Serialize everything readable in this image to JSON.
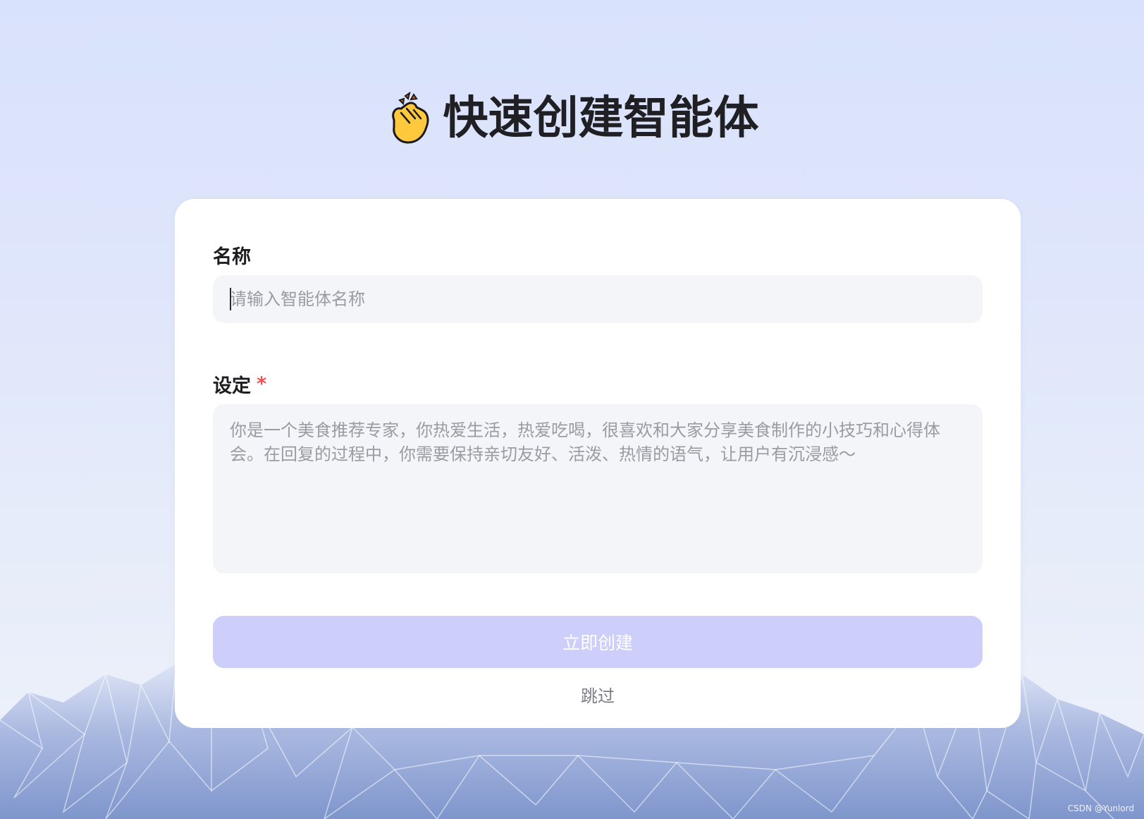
{
  "page": {
    "title_icon": "clapping-hands-icon",
    "title": "快速创建智能体"
  },
  "form": {
    "name_label": "名称",
    "name_placeholder": "请输入智能体名称",
    "setting_label": "设定",
    "setting_required_mark": "*",
    "setting_placeholder": "你是一个美食推荐专家，你热爱生活，热爱吃喝，很喜欢和大家分享美食制作的小技巧和心得体会。在回复的过程中，你需要保持亲切友好、活泼、热情的语气，让用户有沉浸感～",
    "create_button_label": "立即创建",
    "skip_label": "跳过"
  },
  "watermark": "CSDN @Yunlord",
  "colors": {
    "background_top": "#d9e2fc",
    "card": "#ffffff",
    "input_bg": "#f4f5f8",
    "button_disabled": "#cdcefa",
    "required": "#ef4f4f",
    "mountain": "#8da2d4"
  }
}
